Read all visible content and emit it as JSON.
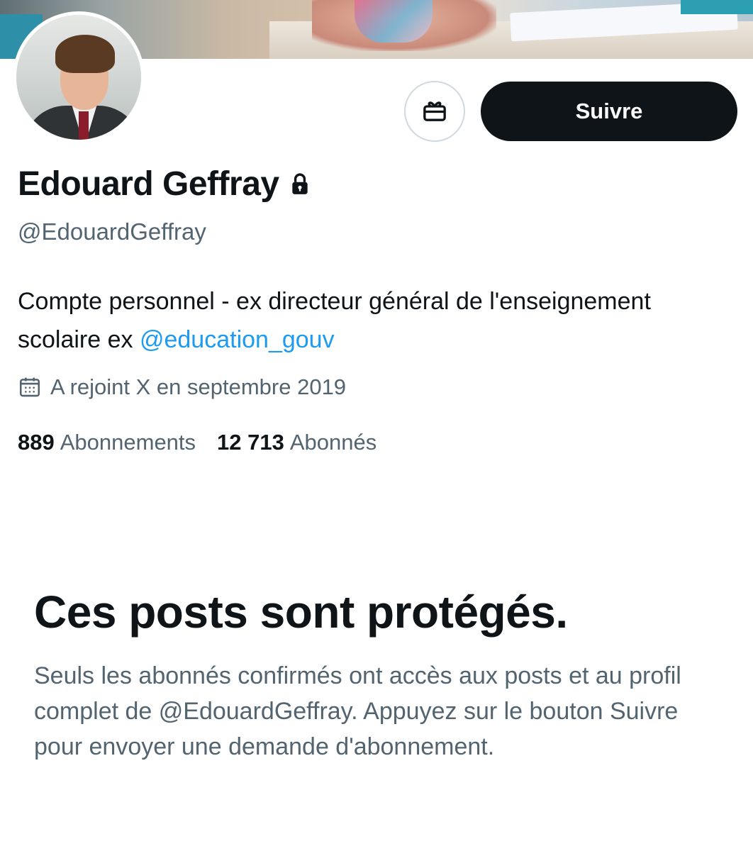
{
  "profile": {
    "name": "Edouard Geffray",
    "handle": "@EdouardGeffray",
    "bio_text": "Compte personnel - ex directeur général de l'enseignement scolaire ex ",
    "bio_mention": "@education_gouv",
    "joined": "A rejoint X en septembre 2019",
    "following_count": "889",
    "following_label": "Abonnements",
    "followers_count": "12 713",
    "followers_label": "Abonnés",
    "protected_icon": "lock-icon"
  },
  "actions": {
    "gift_icon": "gift-icon",
    "follow_label": "Suivre"
  },
  "protected_notice": {
    "title": "Ces posts sont protégés.",
    "body": "Seuls les abonnés confirmés ont accès aux posts et au profil complet de @EdouardGeffray. Appuyez sur le bouton Suivre pour envoyer une demande d'abonnement."
  },
  "colors": {
    "text_primary": "#0f1419",
    "text_secondary": "#536471",
    "link": "#1d9bf0",
    "button_bg": "#0f1419",
    "border": "#cfd9de"
  }
}
